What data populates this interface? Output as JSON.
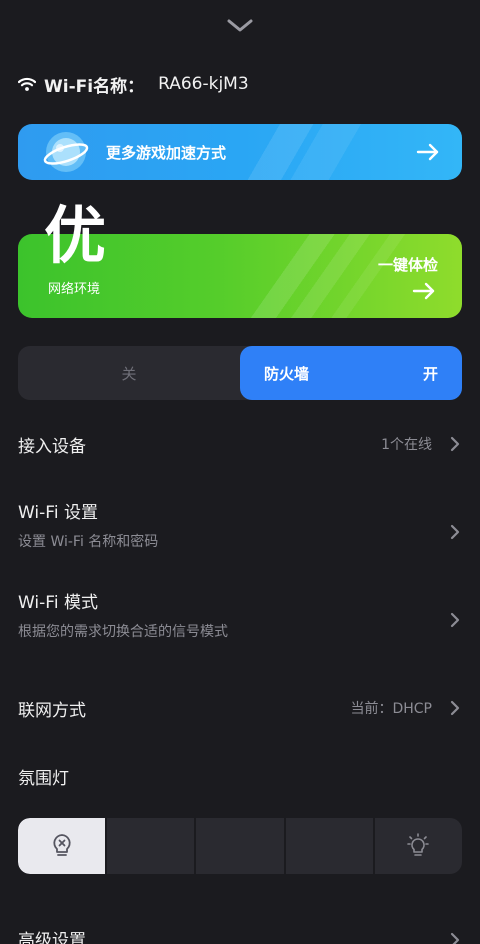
{
  "header": {
    "collapse_icon": "chevron-down-icon"
  },
  "wifi": {
    "icon": "wifi-icon",
    "label": "Wi-Fi名称：",
    "ssid": "RA66-kjM3"
  },
  "boost_banner": {
    "icon": "planet-globe-icon",
    "label": "更多游戏加速方式",
    "arrow_icon": "arrow-right-icon",
    "color": "#2aa6f4"
  },
  "network_env": {
    "grade": "优",
    "label": "网络环境",
    "action_label": "一键体检",
    "arrow_icon": "arrow-right-icon",
    "color": "#55cd2b"
  },
  "firewall": {
    "off_label": "关",
    "name": "防火墙",
    "state_label": "开",
    "enabled": true,
    "accent": "#2f80f7"
  },
  "settings": {
    "devices": {
      "title": "接入设备",
      "value": "1个在线"
    },
    "wifi_settings": {
      "title": "Wi-Fi 设置",
      "desc": "设置 Wi-Fi 名称和密码"
    },
    "wifi_mode": {
      "title": "Wi-Fi 模式",
      "desc": "根据您的需求切换合适的信号模式"
    },
    "connection": {
      "title": "联网方式",
      "value": "当前：DHCP"
    },
    "ambient_light": {
      "title": "氛围灯",
      "options": [
        "light-off-icon",
        "",
        "",
        "",
        "light-on-icon"
      ],
      "selected_index": 0
    },
    "advanced": {
      "title": "高级设置"
    }
  }
}
